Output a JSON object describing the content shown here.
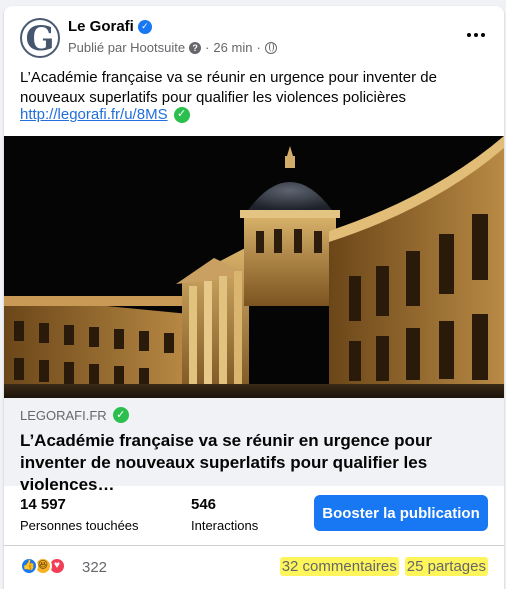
{
  "post": {
    "page_name": "Le Gorafi",
    "avatar_letter": "G",
    "published_by": "Publié par Hootsuite",
    "time": "26 min",
    "text": "L’Académie française va se réunir en urgence pour inventer de nouveaux superlatifs pour qualifier les violences policières",
    "link": "http://legorafi.fr/u/8MS",
    "icons": {
      "verified": "verified-badge-icon",
      "help": "question-icon",
      "audience": "globe-icon",
      "more": "more-options-icon",
      "link_check": "check-circle-icon"
    }
  },
  "preview": {
    "domain": "LEGORAFI.FR",
    "title": "L’Académie française va se réunir en urgence pour inventer de nouveaux superlatifs pour qualifier les violences…"
  },
  "insights": {
    "reach_value": "14 597",
    "reach_label": "Personnes touchées",
    "interactions_value": "546",
    "interactions_label": "Interactions",
    "boost_label": "Booster la publication"
  },
  "reactions": {
    "icons": [
      "like-icon",
      "haha-icon",
      "love-icon"
    ],
    "count": "322",
    "comments": "32 commentaires",
    "shares": "25 partages"
  },
  "colors": {
    "accent": "#1877f2",
    "check": "#2bbf4e",
    "highlight": "#fdf55a"
  }
}
